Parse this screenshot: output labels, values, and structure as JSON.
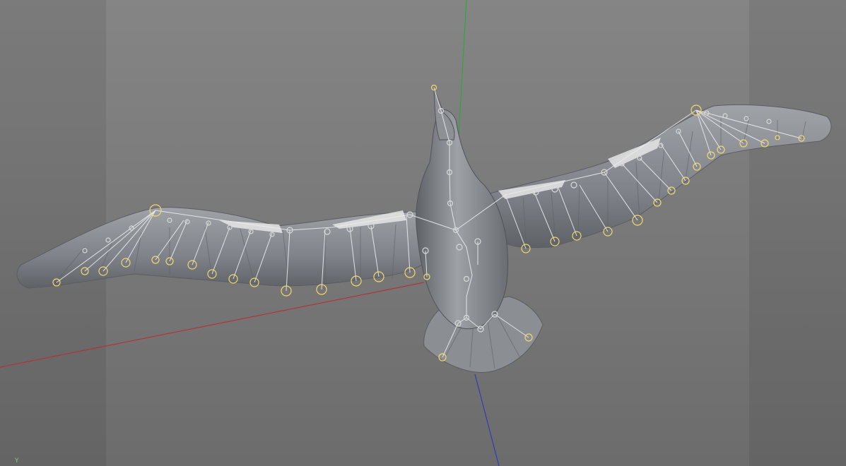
{
  "viewport": {
    "background": "#7c7c7c",
    "world_axis_label": "Y"
  },
  "colors": {
    "axis_x": "#c0282b",
    "axis_y": "#1fae2c",
    "axis_z": "#2633c8",
    "bird_mesh": "#8a8e93",
    "feather": "#9a9ea3",
    "bone": "#e9e9e9",
    "joint_ring": "#f3d86a"
  },
  "scene": {
    "object": "seagull-mesh",
    "rig": "wing-and-body-skeleton",
    "icons": [
      "joint-icon",
      "bone-icon",
      "world-axis-icon"
    ]
  }
}
